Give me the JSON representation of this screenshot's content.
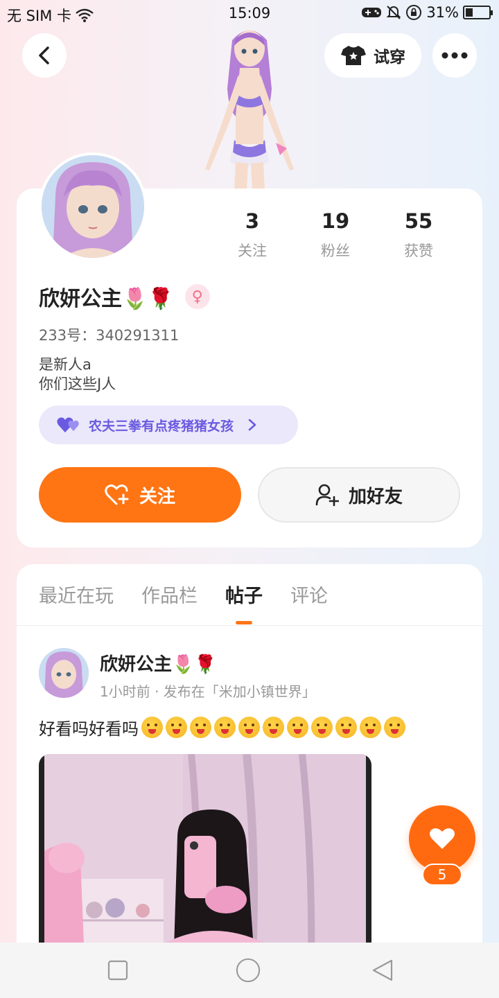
{
  "status_bar": {
    "carrier": "无 SIM 卡",
    "time": "15:09",
    "battery": "31%"
  },
  "header": {
    "try_on_label": "试穿",
    "icons": [
      "back-arrow-icon",
      "tshirt-icon",
      "more-dots-icon"
    ]
  },
  "profile": {
    "name": "欣妍公主🌷🌹",
    "gender_symbol": "♀",
    "uid": "233号：340291311",
    "bio_line1": "是新人a",
    "bio_line2": "你们这些J人",
    "stats": [
      {
        "value": "3",
        "label": "关注"
      },
      {
        "value": "19",
        "label": "粉丝"
      },
      {
        "value": "55",
        "label": "获赞"
      }
    ],
    "group_label": "农夫三拳有点疼猪猪女孩",
    "follow_label": "关注",
    "add_friend_label": "加好友"
  },
  "tabs": [
    {
      "label": "最近在玩"
    },
    {
      "label": "作品栏"
    },
    {
      "label": "帖子",
      "active": true
    },
    {
      "label": "评论"
    }
  ],
  "post": {
    "author": "欣妍公主🌷🌹",
    "meta": "1小时前 · 发布在「米加小镇世界」",
    "text": "好看吗好看吗",
    "emoji_count": 11
  },
  "like": {
    "count": "5"
  },
  "colors": {
    "accent": "#ff7514",
    "group_chip_text": "#6a5ae0",
    "group_chip_bg": "#ebe8fb"
  }
}
